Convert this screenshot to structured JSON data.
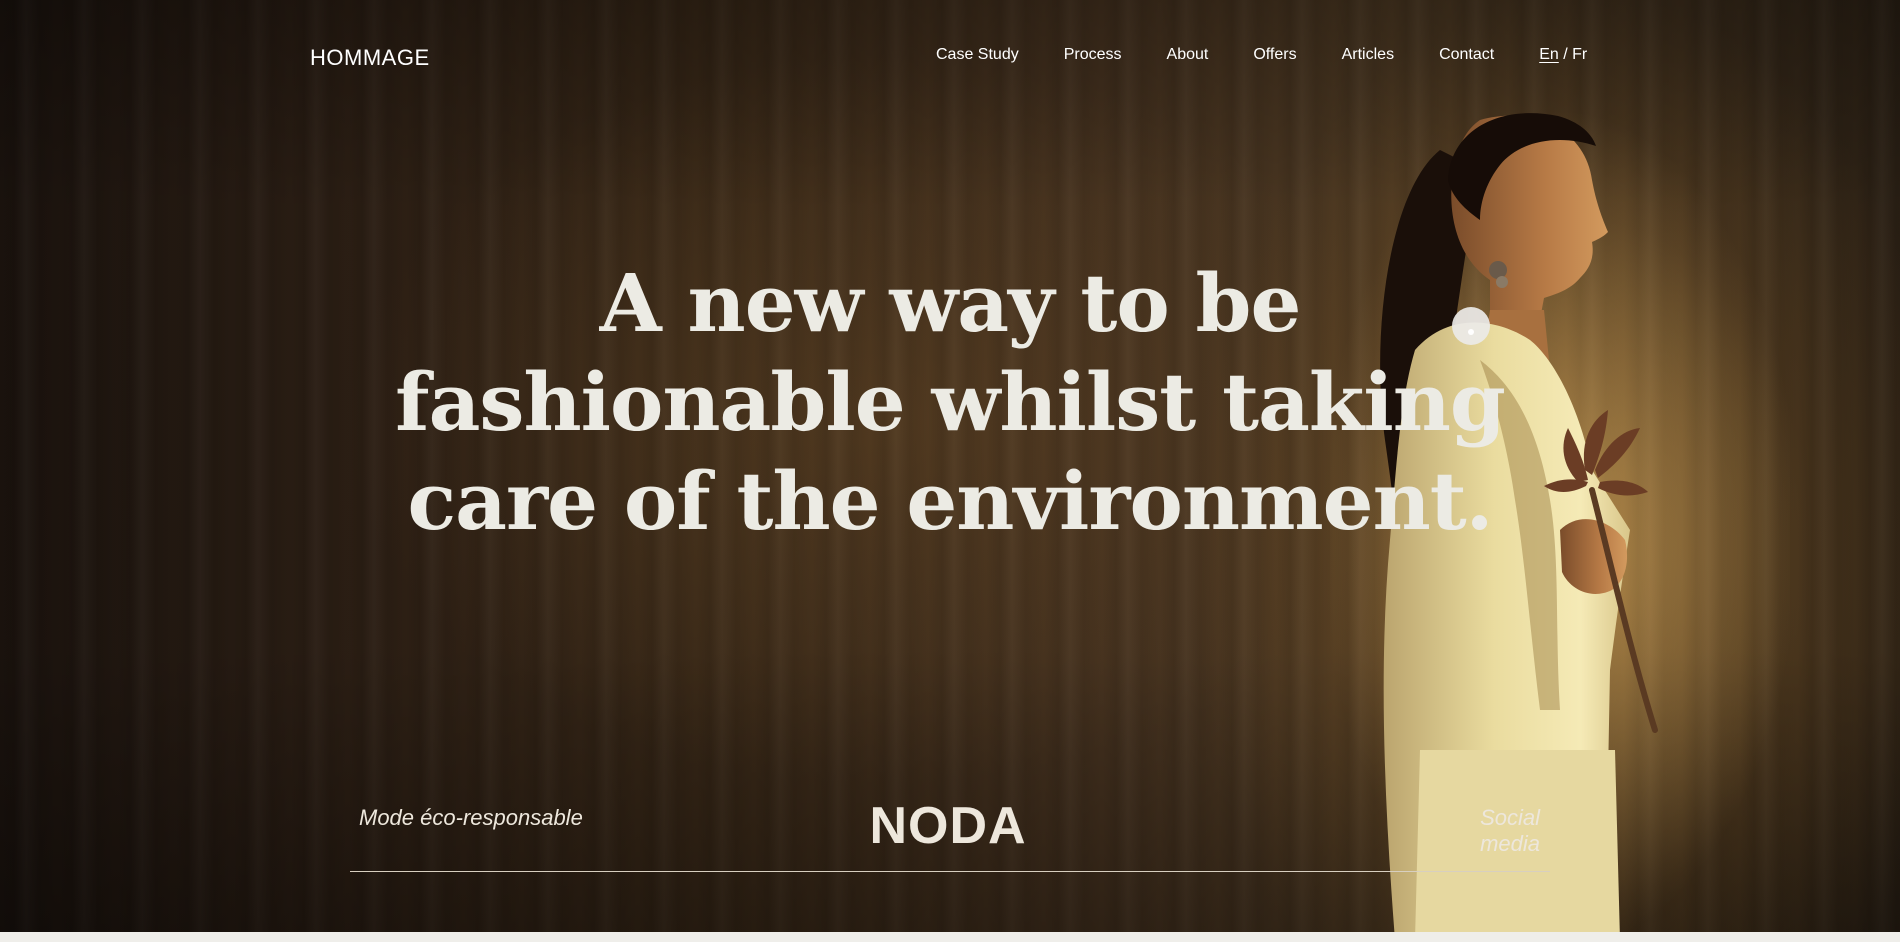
{
  "header": {
    "logo": "HOMMAGE",
    "nav": [
      {
        "label": "Case Study"
      },
      {
        "label": "Process"
      },
      {
        "label": "About"
      },
      {
        "label": "Offers"
      },
      {
        "label": "Articles"
      },
      {
        "label": "Contact"
      }
    ],
    "language": {
      "active": "En",
      "separator": " / ",
      "other": "Fr"
    }
  },
  "hero": {
    "headline_lines": [
      "A new way to be",
      "fashionable whilst taking",
      "care of the environment."
    ],
    "image": "woman-in-cream-suit-holding-dried-flower"
  },
  "footer_bar": {
    "left_text": "Mode éco-responsable",
    "brand_logo": "NODA",
    "right_link": "Social media"
  },
  "colors": {
    "headline": "#ecebe4",
    "nav_text": "#ffffff",
    "accent_text": "#ede7dc",
    "background_dark": "#2b1e14",
    "page_strip": "#efeeea"
  }
}
